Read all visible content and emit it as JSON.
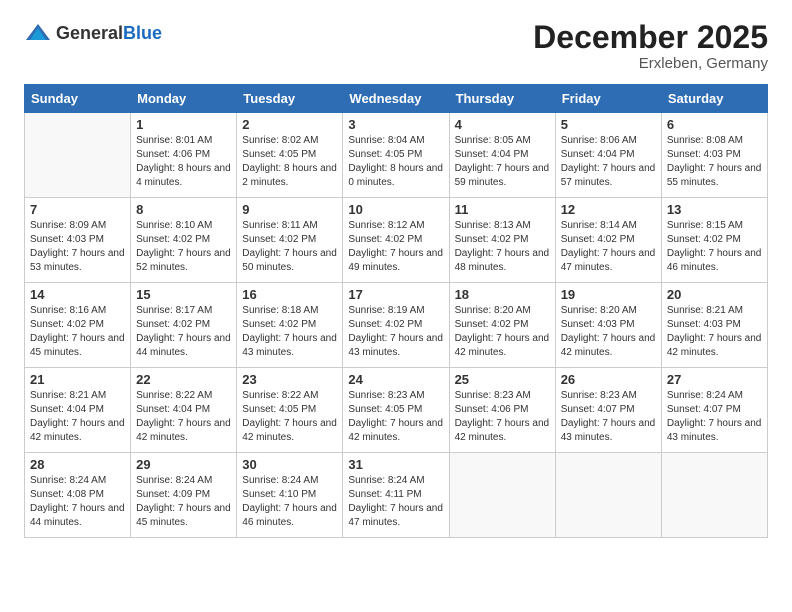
{
  "logo": {
    "general": "General",
    "blue": "Blue"
  },
  "title": "December 2025",
  "location": "Erxleben, Germany",
  "weekdays": [
    "Sunday",
    "Monday",
    "Tuesday",
    "Wednesday",
    "Thursday",
    "Friday",
    "Saturday"
  ],
  "weeks": [
    [
      {
        "day": "",
        "sunrise": "",
        "sunset": "",
        "daylight": ""
      },
      {
        "day": "1",
        "sunrise": "Sunrise: 8:01 AM",
        "sunset": "Sunset: 4:06 PM",
        "daylight": "Daylight: 8 hours and 4 minutes."
      },
      {
        "day": "2",
        "sunrise": "Sunrise: 8:02 AM",
        "sunset": "Sunset: 4:05 PM",
        "daylight": "Daylight: 8 hours and 2 minutes."
      },
      {
        "day": "3",
        "sunrise": "Sunrise: 8:04 AM",
        "sunset": "Sunset: 4:05 PM",
        "daylight": "Daylight: 8 hours and 0 minutes."
      },
      {
        "day": "4",
        "sunrise": "Sunrise: 8:05 AM",
        "sunset": "Sunset: 4:04 PM",
        "daylight": "Daylight: 7 hours and 59 minutes."
      },
      {
        "day": "5",
        "sunrise": "Sunrise: 8:06 AM",
        "sunset": "Sunset: 4:04 PM",
        "daylight": "Daylight: 7 hours and 57 minutes."
      },
      {
        "day": "6",
        "sunrise": "Sunrise: 8:08 AM",
        "sunset": "Sunset: 4:03 PM",
        "daylight": "Daylight: 7 hours and 55 minutes."
      }
    ],
    [
      {
        "day": "7",
        "sunrise": "Sunrise: 8:09 AM",
        "sunset": "Sunset: 4:03 PM",
        "daylight": "Daylight: 7 hours and 53 minutes."
      },
      {
        "day": "8",
        "sunrise": "Sunrise: 8:10 AM",
        "sunset": "Sunset: 4:02 PM",
        "daylight": "Daylight: 7 hours and 52 minutes."
      },
      {
        "day": "9",
        "sunrise": "Sunrise: 8:11 AM",
        "sunset": "Sunset: 4:02 PM",
        "daylight": "Daylight: 7 hours and 50 minutes."
      },
      {
        "day": "10",
        "sunrise": "Sunrise: 8:12 AM",
        "sunset": "Sunset: 4:02 PM",
        "daylight": "Daylight: 7 hours and 49 minutes."
      },
      {
        "day": "11",
        "sunrise": "Sunrise: 8:13 AM",
        "sunset": "Sunset: 4:02 PM",
        "daylight": "Daylight: 7 hours and 48 minutes."
      },
      {
        "day": "12",
        "sunrise": "Sunrise: 8:14 AM",
        "sunset": "Sunset: 4:02 PM",
        "daylight": "Daylight: 7 hours and 47 minutes."
      },
      {
        "day": "13",
        "sunrise": "Sunrise: 8:15 AM",
        "sunset": "Sunset: 4:02 PM",
        "daylight": "Daylight: 7 hours and 46 minutes."
      }
    ],
    [
      {
        "day": "14",
        "sunrise": "Sunrise: 8:16 AM",
        "sunset": "Sunset: 4:02 PM",
        "daylight": "Daylight: 7 hours and 45 minutes."
      },
      {
        "day": "15",
        "sunrise": "Sunrise: 8:17 AM",
        "sunset": "Sunset: 4:02 PM",
        "daylight": "Daylight: 7 hours and 44 minutes."
      },
      {
        "day": "16",
        "sunrise": "Sunrise: 8:18 AM",
        "sunset": "Sunset: 4:02 PM",
        "daylight": "Daylight: 7 hours and 43 minutes."
      },
      {
        "day": "17",
        "sunrise": "Sunrise: 8:19 AM",
        "sunset": "Sunset: 4:02 PM",
        "daylight": "Daylight: 7 hours and 43 minutes."
      },
      {
        "day": "18",
        "sunrise": "Sunrise: 8:20 AM",
        "sunset": "Sunset: 4:02 PM",
        "daylight": "Daylight: 7 hours and 42 minutes."
      },
      {
        "day": "19",
        "sunrise": "Sunrise: 8:20 AM",
        "sunset": "Sunset: 4:03 PM",
        "daylight": "Daylight: 7 hours and 42 minutes."
      },
      {
        "day": "20",
        "sunrise": "Sunrise: 8:21 AM",
        "sunset": "Sunset: 4:03 PM",
        "daylight": "Daylight: 7 hours and 42 minutes."
      }
    ],
    [
      {
        "day": "21",
        "sunrise": "Sunrise: 8:21 AM",
        "sunset": "Sunset: 4:04 PM",
        "daylight": "Daylight: 7 hours and 42 minutes."
      },
      {
        "day": "22",
        "sunrise": "Sunrise: 8:22 AM",
        "sunset": "Sunset: 4:04 PM",
        "daylight": "Daylight: 7 hours and 42 minutes."
      },
      {
        "day": "23",
        "sunrise": "Sunrise: 8:22 AM",
        "sunset": "Sunset: 4:05 PM",
        "daylight": "Daylight: 7 hours and 42 minutes."
      },
      {
        "day": "24",
        "sunrise": "Sunrise: 8:23 AM",
        "sunset": "Sunset: 4:05 PM",
        "daylight": "Daylight: 7 hours and 42 minutes."
      },
      {
        "day": "25",
        "sunrise": "Sunrise: 8:23 AM",
        "sunset": "Sunset: 4:06 PM",
        "daylight": "Daylight: 7 hours and 42 minutes."
      },
      {
        "day": "26",
        "sunrise": "Sunrise: 8:23 AM",
        "sunset": "Sunset: 4:07 PM",
        "daylight": "Daylight: 7 hours and 43 minutes."
      },
      {
        "day": "27",
        "sunrise": "Sunrise: 8:24 AM",
        "sunset": "Sunset: 4:07 PM",
        "daylight": "Daylight: 7 hours and 43 minutes."
      }
    ],
    [
      {
        "day": "28",
        "sunrise": "Sunrise: 8:24 AM",
        "sunset": "Sunset: 4:08 PM",
        "daylight": "Daylight: 7 hours and 44 minutes."
      },
      {
        "day": "29",
        "sunrise": "Sunrise: 8:24 AM",
        "sunset": "Sunset: 4:09 PM",
        "daylight": "Daylight: 7 hours and 45 minutes."
      },
      {
        "day": "30",
        "sunrise": "Sunrise: 8:24 AM",
        "sunset": "Sunset: 4:10 PM",
        "daylight": "Daylight: 7 hours and 46 minutes."
      },
      {
        "day": "31",
        "sunrise": "Sunrise: 8:24 AM",
        "sunset": "Sunset: 4:11 PM",
        "daylight": "Daylight: 7 hours and 47 minutes."
      },
      {
        "day": "",
        "sunrise": "",
        "sunset": "",
        "daylight": ""
      },
      {
        "day": "",
        "sunrise": "",
        "sunset": "",
        "daylight": ""
      },
      {
        "day": "",
        "sunrise": "",
        "sunset": "",
        "daylight": ""
      }
    ]
  ]
}
